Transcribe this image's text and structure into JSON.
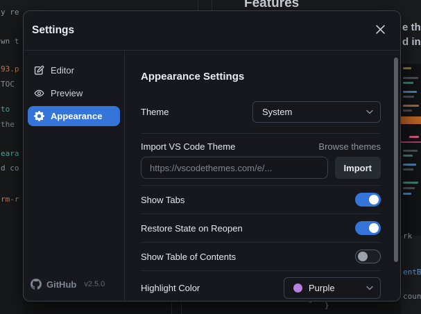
{
  "background": {
    "features_heading": "Features",
    "left_code_fragments": [
      {
        "text": "y re",
        "color": "gray"
      },
      {
        "text": "wn t",
        "color": "gray"
      },
      {
        "text": "93.p",
        "color": "orange"
      },
      {
        "text": "TOC",
        "color": "gray"
      },
      {
        "text": "to",
        "color": "teal"
      },
      {
        "text": "the",
        "color": "slate"
      },
      {
        "text": "eara",
        "color": "teal"
      },
      {
        "text": "d co",
        "color": "gray"
      },
      {
        "text": "rm-r",
        "color": "orange"
      }
    ],
    "right_fragments": {
      "line1": "e th",
      "line2": "d in",
      "code_rk": "rk",
      "code_entby": "entBy.",
      "code_count": "count]",
      "brace": "}",
      "circle_glyph": "°"
    }
  },
  "modal": {
    "title": "Settings",
    "sidebar": {
      "items": [
        {
          "label": "Editor",
          "icon": "pencil-icon",
          "selected": false
        },
        {
          "label": "Preview",
          "icon": "eye-icon",
          "selected": false
        },
        {
          "label": "Appearance",
          "icon": "gear-icon",
          "selected": true
        }
      ],
      "footer": {
        "brand": "GitHub",
        "version": "v2.5.0"
      }
    },
    "content": {
      "heading": "Appearance Settings",
      "theme": {
        "label": "Theme",
        "value": "System"
      },
      "import_theme": {
        "label": "Import VS Code Theme",
        "browse_link": "Browse themes",
        "placeholder": "https://vscodethemes.com/e/...",
        "button_label": "Import"
      },
      "toggles": [
        {
          "label": "Show Tabs",
          "on": true
        },
        {
          "label": "Restore State on Reopen",
          "on": true
        },
        {
          "label": "Show Table of Contents",
          "on": false
        }
      ],
      "highlight_color": {
        "label": "Highlight Color",
        "value": "Purple",
        "swatch_hex": "#b77ee3"
      }
    },
    "colors": {
      "accent_blue": "#3575d9",
      "toggle_on": "#3575d9",
      "purple_swatch": "#b77ee3"
    }
  }
}
